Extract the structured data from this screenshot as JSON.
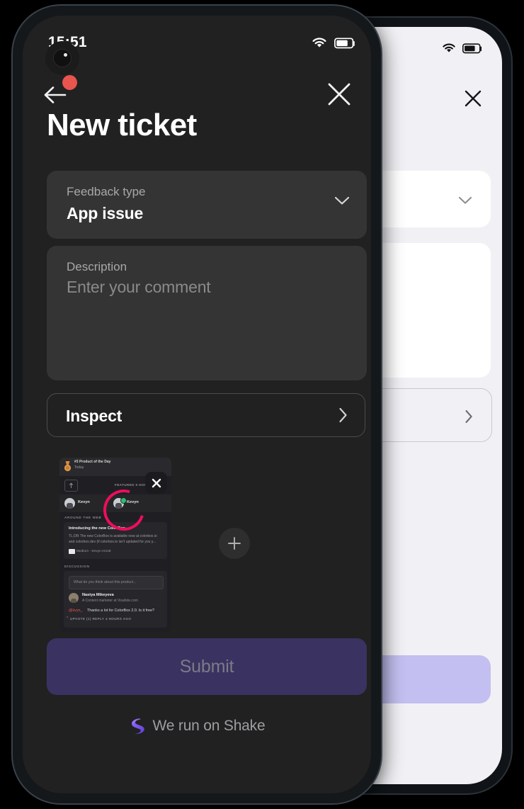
{
  "status_bar": {
    "time": "15:51",
    "wifi_icon": "wifi-icon",
    "battery_icon": "battery-icon",
    "battery_level": 70
  },
  "nav": {
    "back_icon": "arrow-left-icon",
    "back_badge": "notification-dot",
    "close_icon": "close-icon"
  },
  "header": {
    "title": "New ticket"
  },
  "form": {
    "feedback_type": {
      "label": "Feedback type",
      "value": "App issue",
      "chevron_icon": "chevron-down-icon"
    },
    "description": {
      "label": "Description",
      "placeholder": "Enter your comment",
      "value": ""
    },
    "inspect": {
      "label": "Inspect",
      "chevron_icon": "chevron-right-icon"
    }
  },
  "attachments": {
    "add_icon": "plus-icon",
    "thumbnail": {
      "close_icon": "close-icon",
      "badge_icon": "medal-icon",
      "badge_title": "#3 Product of the Day",
      "badge_subtitle": "Today",
      "share_icon": "share-icon",
      "featured_label": "FEATURED 5 HOURS AGO",
      "users": [
        {
          "name": "Kevyn"
        },
        {
          "name": "Kevyn"
        }
      ],
      "section_around_web": "AROUND THE WEB",
      "article": {
        "title": "Introducing the new ColorBox",
        "body": "TL;DR The new ColorBox is available now at colorbox.io and colorbox.dev (if colorbox.io isn't updated for you y...",
        "source": "Medium - Kevyn Arnott"
      },
      "section_discussion": "DISCUSSION",
      "comment_input_placeholder": "What do you think about this product...",
      "comment": {
        "author": "Nastya Mikeyeva",
        "role": "A Content marketer at Visafote.com",
        "handle": "@kvyn_",
        "text": "Thanks a lot for ColorBox 2.0. Is it free?",
        "meta": "UPVOTE (1)   REPLY   4 HOURS AGO"
      },
      "annotation_color": "#EE0D5B"
    }
  },
  "submit": {
    "label": "Submit",
    "background": "#3A3361",
    "text_color": "#7C7A88"
  },
  "footer": {
    "logo_icon": "shake-logo-icon",
    "text": "We run on Shake"
  },
  "background_phone": {
    "theme": "light",
    "background": "#F1F1F5",
    "card_background": "#FFFFFF",
    "submit_background": "#C3BFF0",
    "close_icon": "close-icon",
    "chevron_down_icon": "chevron-down-icon",
    "chevron_right_icon": "chevron-right-icon",
    "wifi_icon": "wifi-icon",
    "battery_icon": "battery-icon"
  }
}
